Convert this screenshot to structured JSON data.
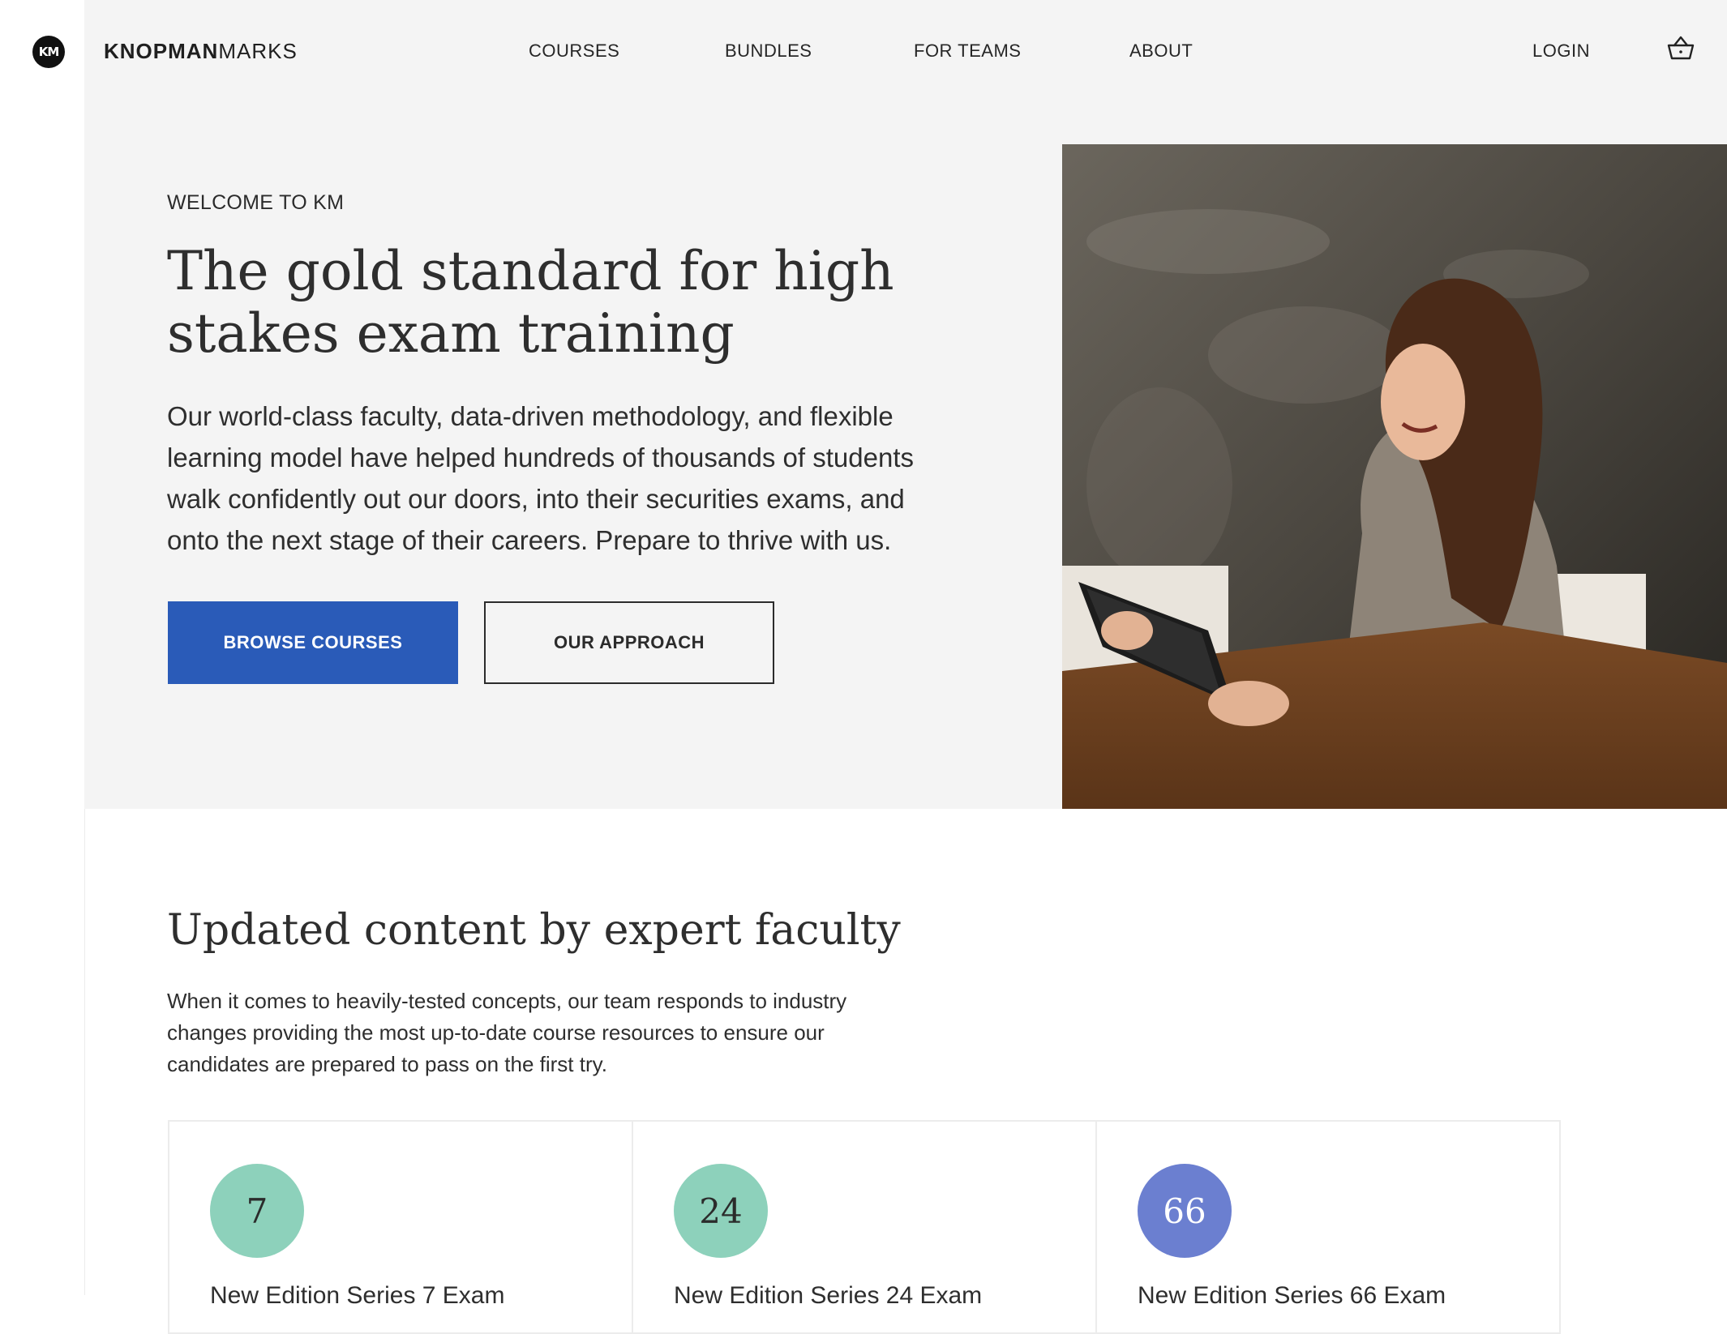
{
  "brand": {
    "badge": "KM",
    "name_bold": "KNOPMAN",
    "name_light": "MARKS"
  },
  "nav": {
    "courses": "COURSES",
    "bundles": "BUNDLES",
    "for_teams": "FOR TEAMS",
    "about": "ABOUT",
    "login": "LOGIN",
    "cart_icon": "basket-icon"
  },
  "hero": {
    "eyebrow": "WELCOME TO KM",
    "title": "The gold standard for high stakes exam training",
    "body": "Our world-class faculty, data-driven methodology, and flexible learning model have helped hundreds of thousands of students walk confidently out our doors, into their securities exams, and onto the next stage of their careers. Prepare to thrive with us.",
    "primary_button": "BROWSE COURSES",
    "secondary_button": "OUR APPROACH",
    "image_alt": "Smiling woman holding a tablet at a wooden table"
  },
  "section": {
    "title": "Updated content by expert faculty",
    "body": "When it comes to heavily-tested concepts, our team responds to industry changes providing the most up-to-date course resources to ensure our candidates are prepared to pass on the first try."
  },
  "stats": [
    {
      "number": "7",
      "label": "New Edition Series 7 Exam",
      "color": "#8dd1bb",
      "text_color": "#2b2b2b"
    },
    {
      "number": "24",
      "label": "New Edition Series 24 Exam",
      "color": "#8dd1bb",
      "text_color": "#2b2b2b"
    },
    {
      "number": "66",
      "label": "New Edition Series 66 Exam",
      "color": "#6b7fd0",
      "text_color": "#ffffff"
    }
  ],
  "colors": {
    "primary": "#2a5bb8",
    "hero_bg": "#f4f4f4",
    "text": "#2b2b2b"
  }
}
